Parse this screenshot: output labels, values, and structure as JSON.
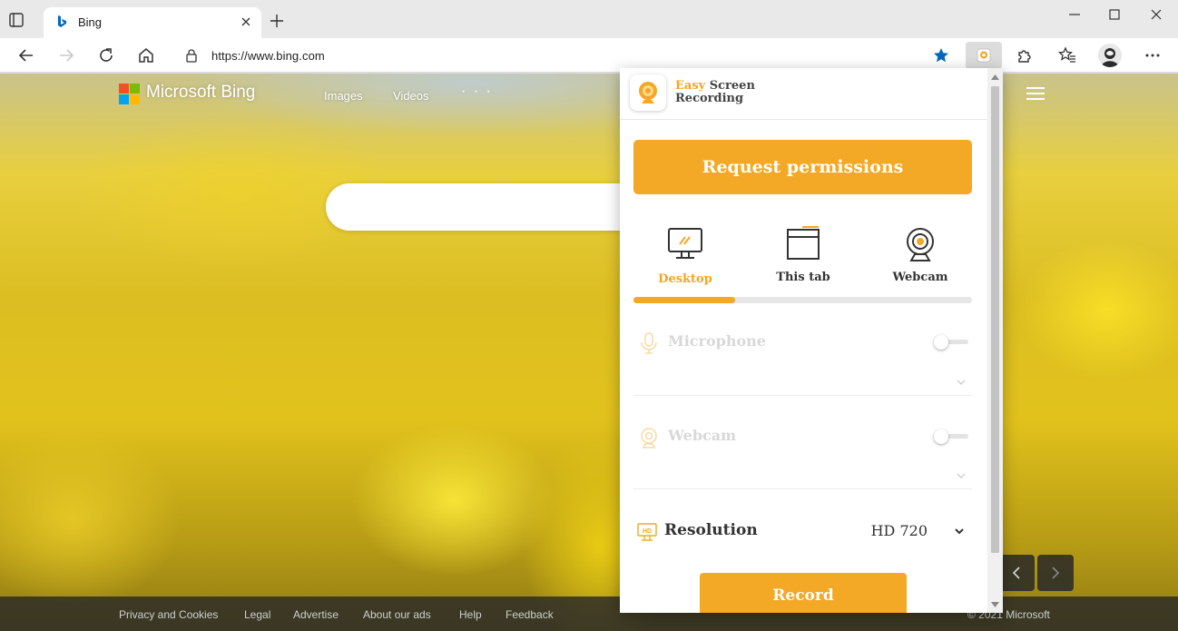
{
  "browser": {
    "tab_title": "Bing",
    "url": "https://www.bing.com"
  },
  "bing": {
    "logo_text": "Microsoft Bing",
    "nav": [
      "Images",
      "Videos"
    ],
    "more": "· · ·",
    "footer_links": [
      "Privacy and Cookies",
      "Legal",
      "Advertise",
      "About our ads",
      "Help",
      "Feedback"
    ],
    "copyright": "© 2021 Microsoft"
  },
  "extension": {
    "brand_easy": "Easy",
    "brand_screen": " Screen",
    "brand_recording": "Recording",
    "request_button": "Request permissions",
    "modes": [
      {
        "label": "Desktop",
        "icon": "monitor-icon"
      },
      {
        "label": "This tab",
        "icon": "browser-window-icon"
      },
      {
        "label": "Webcam",
        "icon": "webcam-icon"
      }
    ],
    "active_mode": "Desktop",
    "microphone_label": "Microphone",
    "microphone_on": false,
    "webcam_label": "Webcam",
    "webcam_on": false,
    "resolution_label": "Resolution",
    "resolution_value": "HD 720",
    "hd_badge": "HD",
    "record_button": "Record"
  },
  "colors": {
    "accent": "#f3a826",
    "edge_blue": "#0067c0",
    "ms_red": "#f25022",
    "ms_green": "#7fba00",
    "ms_blue": "#00a4ef",
    "ms_yellow": "#ffb900"
  }
}
